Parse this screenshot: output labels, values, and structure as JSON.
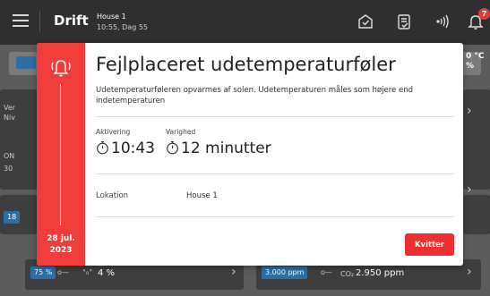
{
  "topbar": {
    "app_name": "Drift",
    "house_name": "House 1",
    "house_time": "10:55, Dag 55",
    "notification_count": "7"
  },
  "background": {
    "temp_readout": "0 °C",
    "temp_unit_line": "%",
    "card_left_top_lines": [
      "Ver",
      "Niv"
    ],
    "card_left_on": "ON",
    "card_left_num": "30",
    "card_left_mid_pill": "18",
    "bottom_left_pill": "75 %",
    "bottom_left_value": "4 %",
    "bottom_right_pill": "3.000 ppm",
    "bottom_right_label": "CO₂",
    "bottom_right_value": "2.950 ppm"
  },
  "alarm": {
    "title": "Fejlplaceret udetemperaturføler",
    "description": "Udetemperaturføleren opvarmes af solen. Udetemperaturen måles som højere end indetemperaturen",
    "activation_label": "Aktivering",
    "activation_time": "10:43",
    "duration_label": "Varighed",
    "duration_value": "12 minutter",
    "location_label": "Lokation",
    "location_value": "House 1",
    "date_line1": "28 jul.",
    "date_line2": "2023",
    "acknowledge_label": "Kvitter",
    "accent_color": "#f13c3c"
  }
}
